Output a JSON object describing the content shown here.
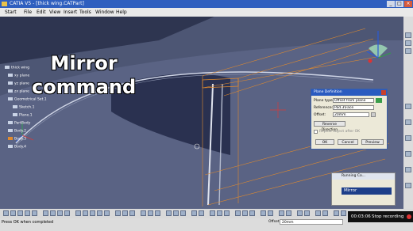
{
  "window": {
    "title": "CATIA V5 - [thick wing.CATPart]",
    "minimize": "_",
    "maximize": "□",
    "close": "×"
  },
  "menu": {
    "items": [
      "Start",
      "File",
      "Edit",
      "View",
      "Insert",
      "Tools",
      "Window",
      "Help"
    ]
  },
  "overlay": {
    "line1": "Mirror",
    "line2": "command"
  },
  "tree": {
    "items": [
      {
        "label": "thick wing",
        "icon": "part-icon"
      },
      {
        "label": "xy plane",
        "icon": "plane-icon"
      },
      {
        "label": "yz plane",
        "icon": "plane-icon"
      },
      {
        "label": "zx plane",
        "icon": "plane-icon"
      },
      {
        "label": "Geometrical Set.1",
        "icon": "geoset-icon"
      },
      {
        "label": "Sketch.1",
        "icon": "sketch-icon"
      },
      {
        "label": "Plane.1",
        "icon": "plane-icon"
      },
      {
        "label": "PartBody",
        "icon": "body-icon"
      },
      {
        "label": "Body.2",
        "icon": "body-icon"
      },
      {
        "label": "Body.3",
        "icon": "body-icon"
      },
      {
        "label": "Body.4",
        "icon": "body-icon"
      }
    ]
  },
  "plane_dialog": {
    "title": "Plane Definition",
    "type_label": "Plane type:",
    "type_value": "Offset from plane",
    "reference_label": "Reference:",
    "reference_value": "Pad.3\\Face",
    "offset_label": "Offset:",
    "offset_value": "20mm",
    "reverse_label": "Reverse Direction",
    "repeat_label": "Repeat object after OK",
    "ok": "OK",
    "cancel": "Cancel",
    "preview": "Preview"
  },
  "running_panel": {
    "title": "Running Co...",
    "command": "Mirror"
  },
  "status": {
    "message": "Press OK when completed",
    "offset_label": "Offset",
    "offset_value": "20mm"
  },
  "recorder": {
    "time": "00:03:06",
    "state": "Stop recording"
  },
  "colors": {
    "titlebar": "#2f5fbf",
    "viewport": "#4a5370",
    "orange": "#e08a2e",
    "dialog": "#ece9d8"
  }
}
